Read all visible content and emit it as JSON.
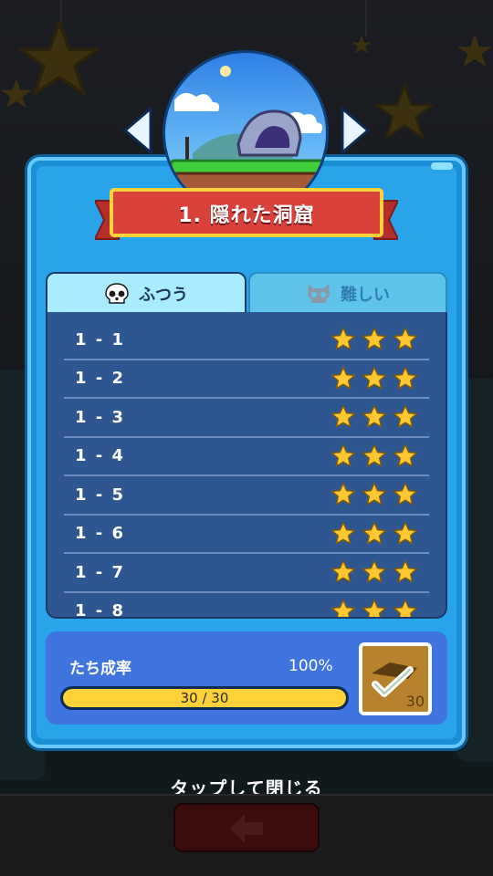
{
  "stage": {
    "title": "1. 隠れた洞窟",
    "image_name": "cave-island-image"
  },
  "tabs": [
    {
      "label": "ふつう",
      "icon": "skull-icon",
      "selected": true
    },
    {
      "label": "難しい",
      "icon": "demon-skull-icon",
      "selected": false
    }
  ],
  "levels": [
    {
      "label": "1 - 1",
      "stars": 3
    },
    {
      "label": "1 - 2",
      "stars": 3
    },
    {
      "label": "1 - 3",
      "stars": 3
    },
    {
      "label": "1 - 4",
      "stars": 3
    },
    {
      "label": "1 - 5",
      "stars": 3
    },
    {
      "label": "1 - 6",
      "stars": 3
    },
    {
      "label": "1 - 7",
      "stars": 3
    },
    {
      "label": "1 - 8",
      "stars": 3
    }
  ],
  "progress": {
    "label": "たち成率",
    "percent_text": "100%",
    "value_text": "30 / 30",
    "fraction": 1.0
  },
  "reward": {
    "count": "30",
    "icon": "checkmark-card-icon"
  },
  "footer": {
    "tap_to_close": "タップして閉じる",
    "back_icon": "back-arrow-icon"
  },
  "colors": {
    "star": "#ffc830",
    "panel_blue": "#29a3ea",
    "list_bg": "#2e5691",
    "ribbon_red": "#d9413b"
  }
}
